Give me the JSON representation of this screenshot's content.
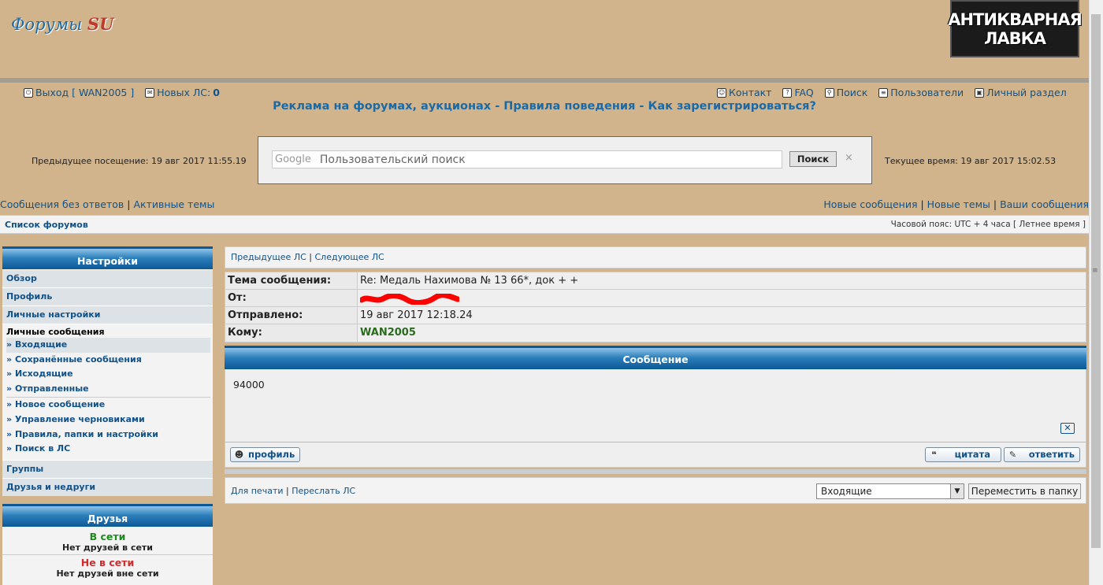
{
  "header": {
    "logo_text": "Форумы",
    "logo_su": "SU",
    "banner_line1": "АНТИКВАРНАЯ",
    "banner_line2": "ЛАВКА"
  },
  "topnav": {
    "logout": "Выход [ WAN2005 ]",
    "new_pm_label": "Новых ЛС:",
    "new_pm_count": "0",
    "contact": "Контакт",
    "faq": "FAQ",
    "search": "Поиск",
    "users": "Пользователи",
    "personal": "Личный раздел"
  },
  "rules_line": "Реклама на форумах, аукционах - Правила поведения - Как зарегистрироваться?",
  "visits": {
    "previous": "Предыдущее посещение: 19 авг 2017 11:55.19",
    "current": "Текущее время: 19 авг 2017 15:02.53"
  },
  "google_search": {
    "brand": "Google",
    "placeholder": "Пользовательский поиск",
    "button": "Поиск",
    "clear": "×"
  },
  "quicklinks": {
    "left": [
      "Сообщения без ответов",
      "Активные темы"
    ],
    "right": [
      "Новые сообщения",
      "Новые темы",
      "Ваши сообщения"
    ]
  },
  "breadcrumb": "Список форумов",
  "timezone": "Часовой пояс: UTC + 4 часа [ Летнее время ]",
  "sidebar": {
    "title": "Настройки",
    "top_items": [
      "Обзор",
      "Профиль",
      "Личные настройки"
    ],
    "pm_title": "Личные сообщения",
    "pm_items": [
      "Входящие",
      "Сохранённые сообщения",
      "Исходящие",
      "Отправленные",
      "Новое сообщение",
      "Управление черновиками",
      "Правила, папки и настройки",
      "Поиск в ЛС"
    ],
    "bottom_items": [
      "Группы",
      "Друзья и недруги"
    ]
  },
  "friends": {
    "title": "Друзья",
    "online_label": "В сети",
    "online_text": "Нет друзей в сети",
    "offline_label": "Не в сети",
    "offline_text": "Нет друзей вне сети"
  },
  "message": {
    "prev_pm": "Предыдущее ЛС",
    "next_pm": "Следующее ЛС",
    "subject_label": "Тема сообщения:",
    "subject": "Re: Медаль Нахимова № 13 66*, док + +",
    "from_label": "От:",
    "sent_label": "Отправлено:",
    "sent": "19 авг 2017 12:18.24",
    "to_label": "Кому:",
    "to": "WAN2005",
    "section_title": "Сообщение",
    "body": "94000",
    "profile_btn": "профиль",
    "quote_btn": "цитата",
    "reply_btn": "ответить",
    "print": "Для печати",
    "forward": "Переслать ЛС",
    "folder_selected": "Входящие",
    "move_btn": "Переместить в папку"
  }
}
